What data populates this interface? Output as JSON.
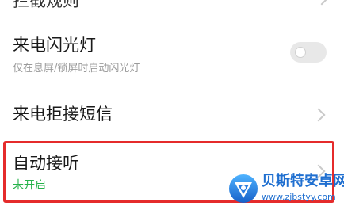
{
  "settings": {
    "top_item": {
      "title": "拦截规则"
    },
    "flash_item": {
      "title": "来电闪光灯",
      "subtitle": "仅在息屏/锁屏时启动闪光灯",
      "toggle_on": false
    },
    "sms_item": {
      "title": "来电拒接短信"
    },
    "auto_answer_item": {
      "title": "自动接听",
      "status": "未开启",
      "status_color": "#26b24a"
    }
  },
  "highlight_color": "#e52b2b",
  "watermark": {
    "name": "贝斯特安卓网",
    "url": "www.zjbstyy.com"
  },
  "icons": [
    "chevron-right-icon",
    "toggle-switch",
    "bestan-logo-icon"
  ]
}
